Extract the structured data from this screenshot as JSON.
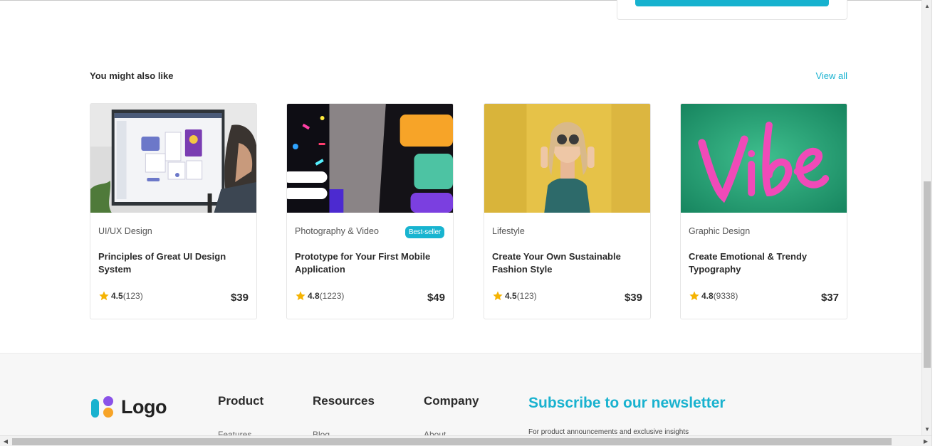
{
  "section": {
    "title": "You might also like",
    "view_all": "View all"
  },
  "cards": [
    {
      "category": "UI/UX Design",
      "title": "Principles of Great UI Design System",
      "rating": "4.5",
      "reviews": "(123)",
      "price": "$39",
      "badge": ""
    },
    {
      "category": "Photography & Video",
      "title": "Prototype for Your First Mobile Application",
      "rating": "4.8",
      "reviews": "(1223)",
      "price": "$49",
      "badge": "Best-seller"
    },
    {
      "category": "Lifestyle",
      "title": "Create Your Own Sustainable Fashion Style",
      "rating": "4.5",
      "reviews": "(123)",
      "price": "$39",
      "badge": ""
    },
    {
      "category": "Graphic Design",
      "title": "Create Emotional & Trendy Typography",
      "rating": "4.8",
      "reviews": "(9338)",
      "price": "$37",
      "badge": ""
    }
  ],
  "footer": {
    "logo_text": "Logo",
    "columns": [
      {
        "title": "Product",
        "first_link": "Features"
      },
      {
        "title": "Resources",
        "first_link": "Blog"
      },
      {
        "title": "Company",
        "first_link": "About"
      }
    ],
    "newsletter_title": "Subscribe to our newsletter",
    "newsletter_sub": "For product announcements and exclusive insights"
  },
  "colors": {
    "accent": "#19b2cf",
    "star": "#f5b301"
  },
  "icons": {
    "star": "star-icon",
    "logo": "logo-mark-icon",
    "scroll_up": "arrow-up-icon",
    "scroll_down": "arrow-down-icon",
    "scroll_left": "arrow-left-icon",
    "scroll_right": "arrow-right-icon"
  }
}
